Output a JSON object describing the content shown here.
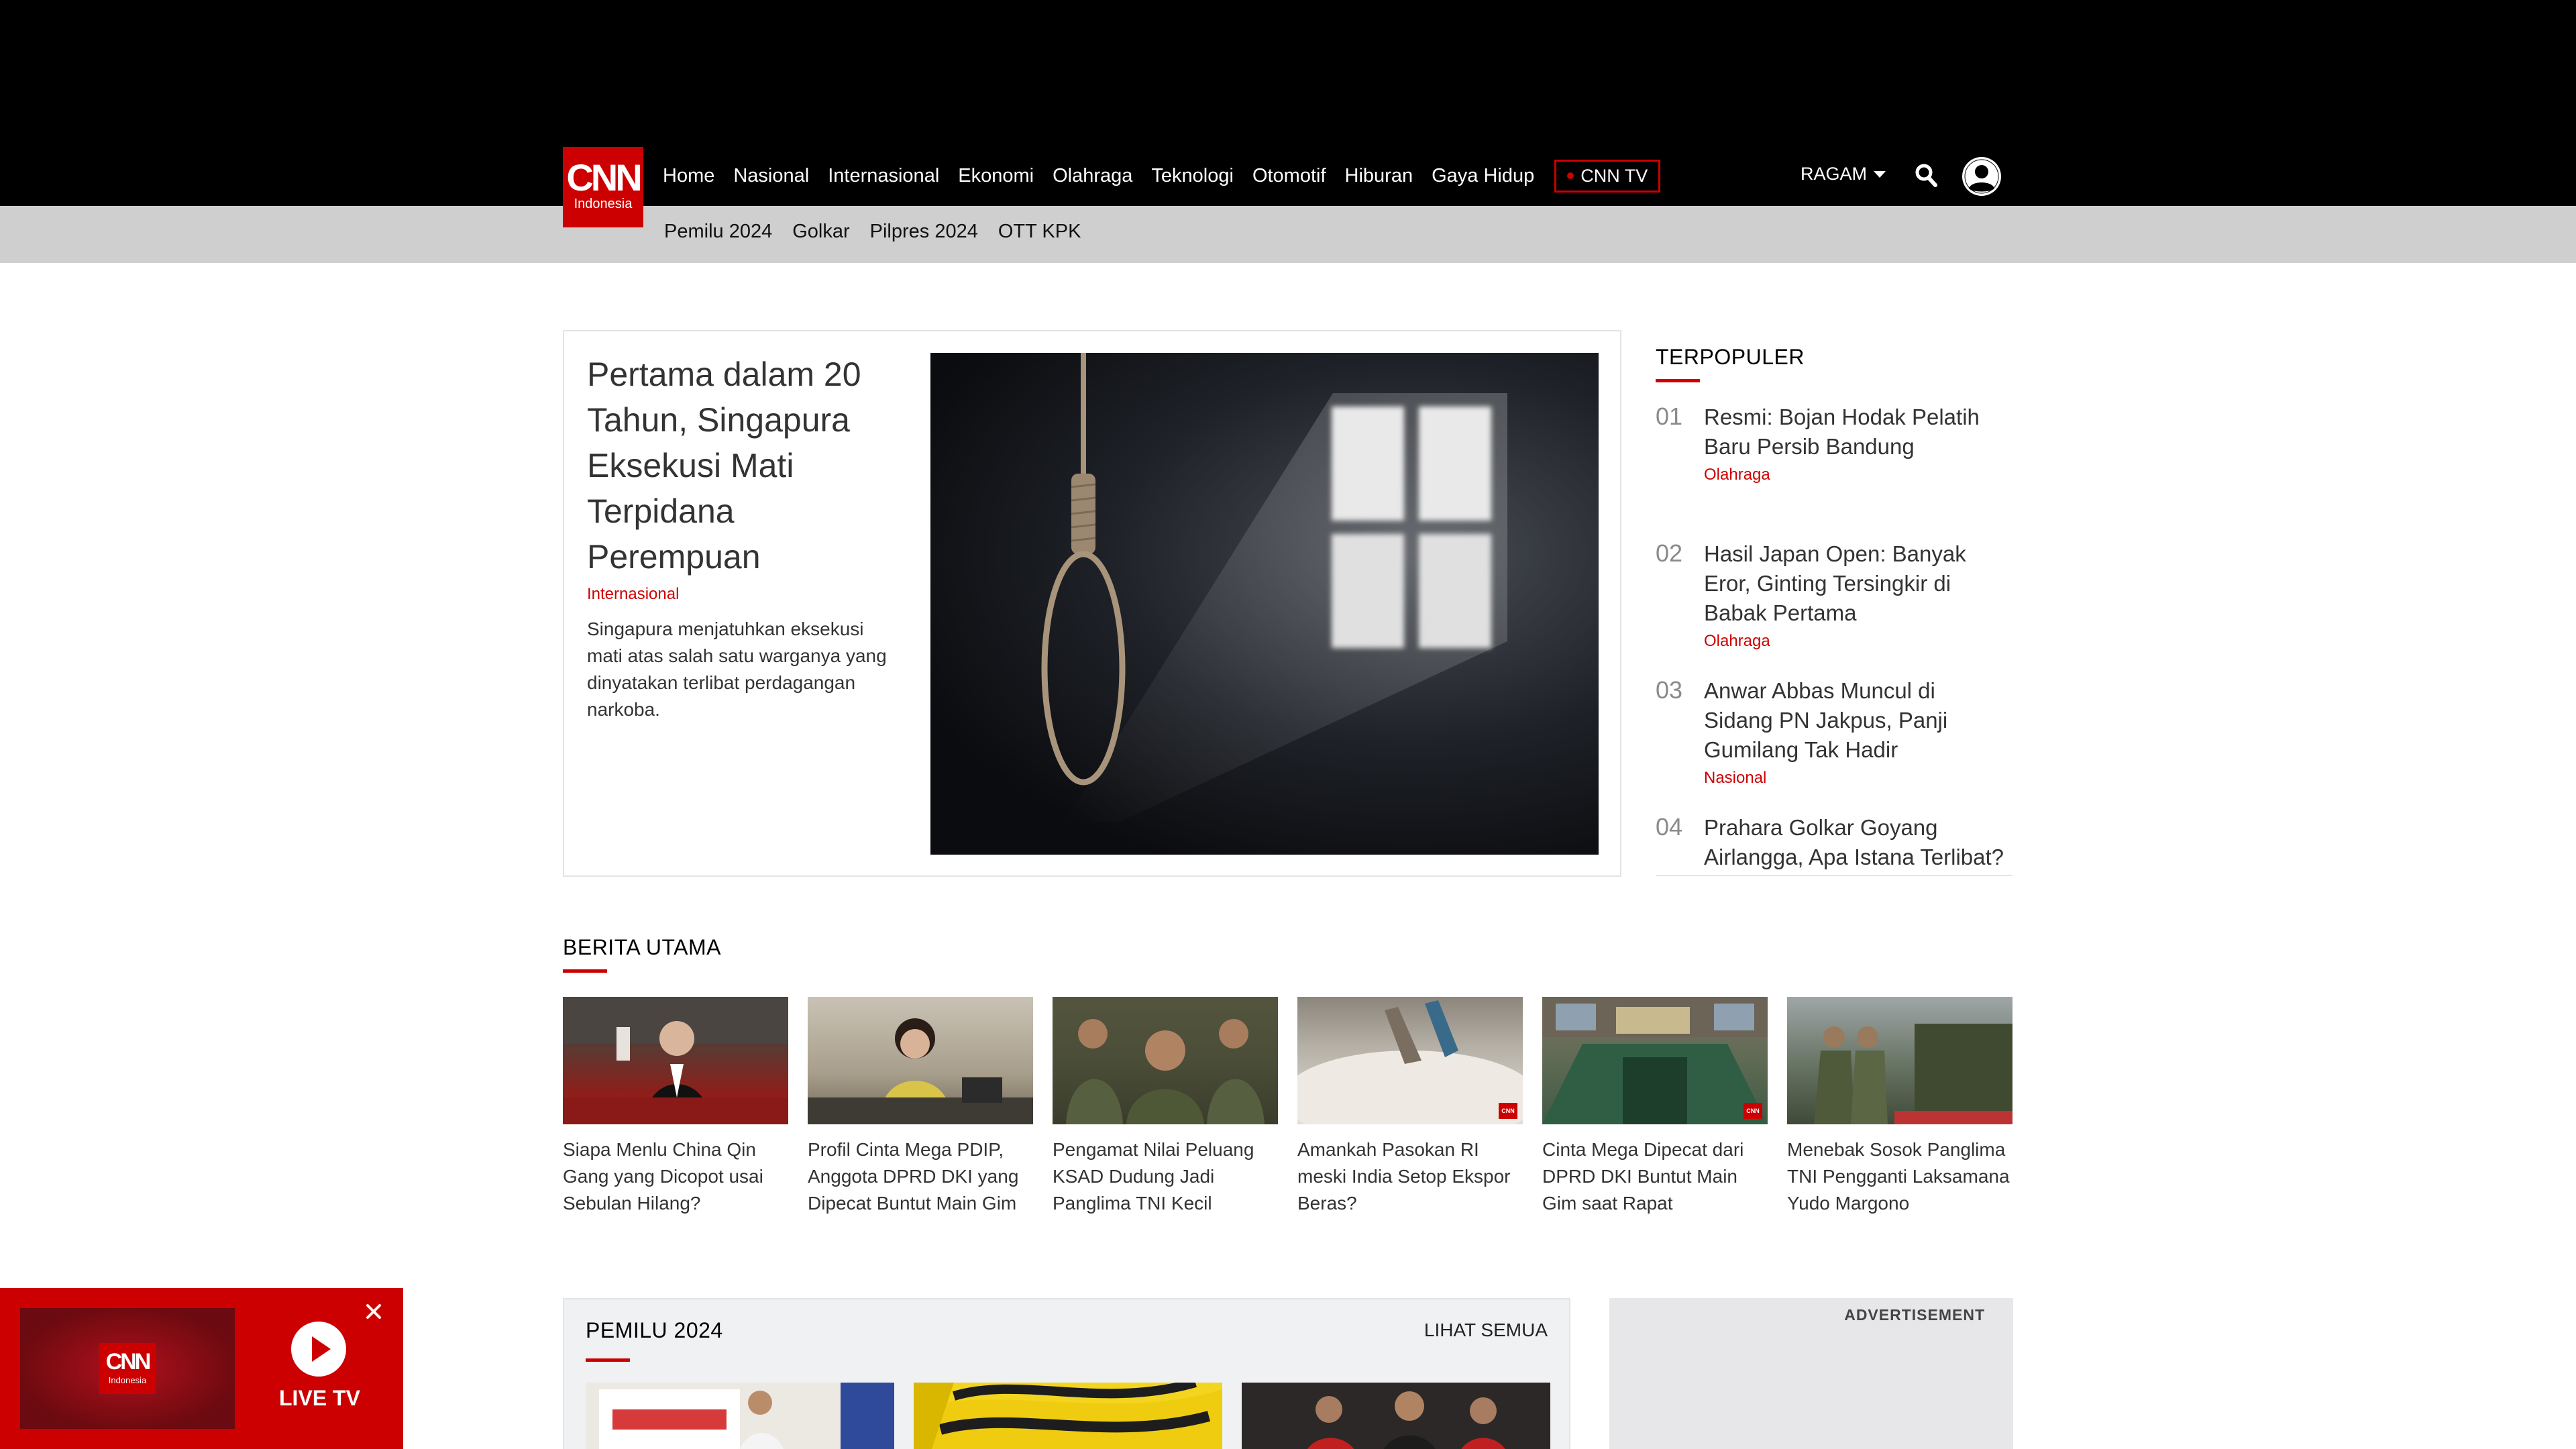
{
  "header": {
    "logo": {
      "line1": "CNN",
      "line2": "Indonesia"
    },
    "nav": [
      "Home",
      "Nasional",
      "Internasional",
      "Ekonomi",
      "Olahraga",
      "Teknologi",
      "Otomotif",
      "Hiburan",
      "Gaya Hidup"
    ],
    "cnntv_label": "CNN TV",
    "ragam_label": "RAGAM",
    "subnav": [
      "Pemilu 2024",
      "Golkar",
      "Pilpres 2024",
      "OTT KPK"
    ]
  },
  "hero": {
    "title": "Pertama dalam 20 Tahun, Singapura Eksekusi Mati Terpidana Perempuan",
    "category": "Internasional",
    "description": "Singapura menjatuhkan eksekusi mati atas salah satu warganya yang dinyatakan terlibat perdagangan narkoba."
  },
  "terpopuler": {
    "title": "TERPOPULER",
    "items": [
      {
        "num": "01",
        "title": "Resmi: Bojan Hodak Pelatih Baru Persib Bandung",
        "category": "Olahraga"
      },
      {
        "num": "02",
        "title": "Hasil Japan Open: Banyak Eror, Ginting Tersingkir di Babak Pertama",
        "category": "Olahraga"
      },
      {
        "num": "03",
        "title": "Anwar Abbas Muncul di Sidang PN Jakpus, Panji Gumilang Tak Hadir",
        "category": "Nasional"
      },
      {
        "num": "04",
        "title": "Prahara Golkar Goyang Airlangga, Apa Istana Terlibat?",
        "category": ""
      }
    ]
  },
  "berita_utama": {
    "title": "BERITA UTAMA",
    "items": [
      {
        "title": "Siapa Menlu China Qin Gang yang Dicopot usai Sebulan Hilang?"
      },
      {
        "title": "Profil Cinta Mega PDIP, Anggota DPRD DKI yang Dipecat Buntut Main Gim"
      },
      {
        "title": "Pengamat Nilai Peluang KSAD Dudung Jadi Panglima TNI Kecil"
      },
      {
        "title": "Amankah Pasokan RI meski India Setop Ekspor Beras?"
      },
      {
        "title": "Cinta Mega Dipecat dari DPRD DKI Buntut Main Gim saat Rapat"
      },
      {
        "title": "Menebak Sosok Panglima TNI Pengganti Laksamana Yudo Margono"
      }
    ],
    "watermark": "CNN"
  },
  "pemilu": {
    "title": "PEMILU 2024",
    "see_all": "LIHAT SEMUA"
  },
  "ad": {
    "label": "ADVERTISEMENT"
  },
  "live_tv": {
    "label": "LIVE TV",
    "logo": {
      "line1": "CNN",
      "line2": "Indonesia"
    }
  },
  "colors": {
    "brand_red": "#cc0000",
    "header_bg": "#000000",
    "subnav_bg": "#cfcfcf"
  },
  "icons": [
    "search-icon",
    "user-icon",
    "play-icon",
    "close-icon",
    "chevron-down-icon"
  ]
}
